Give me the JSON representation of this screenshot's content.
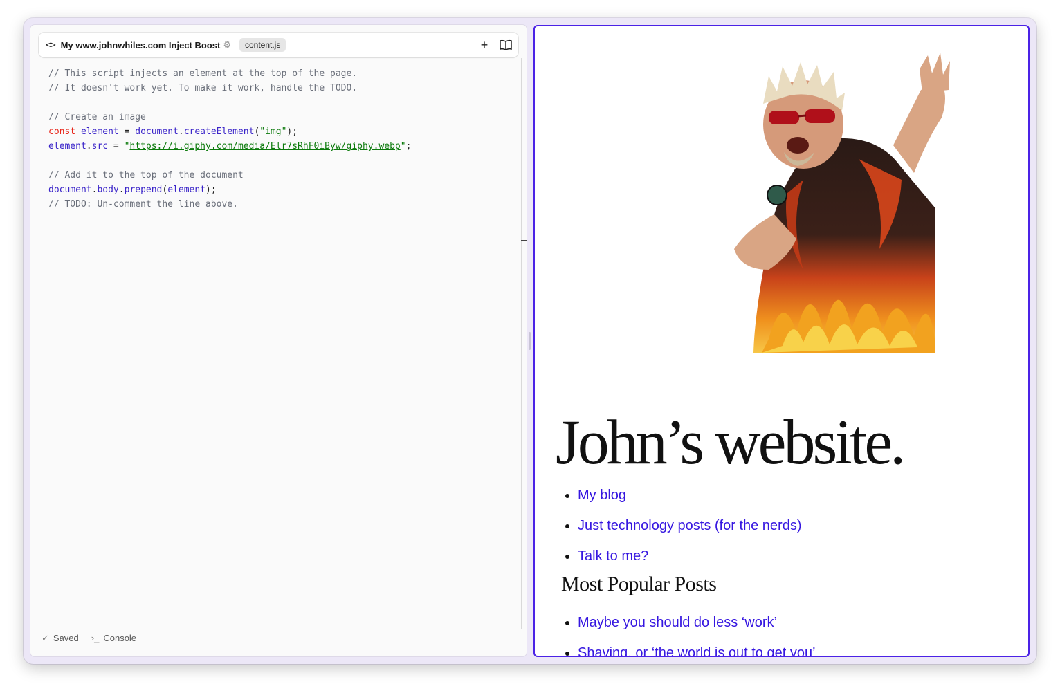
{
  "editor": {
    "project_title": "My www.johnwhiles.com Inject Boost",
    "file_tab": "content.js",
    "code_lines": [
      [
        {
          "t": "// This script injects an element at the top of the page.",
          "c": "c"
        }
      ],
      [
        {
          "t": "// It doesn't work yet. To make it work, handle the TODO.",
          "c": "c"
        }
      ],
      [],
      [
        {
          "t": "// Create an image",
          "c": "c"
        }
      ],
      [
        {
          "t": "const",
          "c": "kw"
        },
        {
          "t": " ",
          "c": "p"
        },
        {
          "t": "element",
          "c": "id"
        },
        {
          "t": " = ",
          "c": "p"
        },
        {
          "t": "document",
          "c": "id"
        },
        {
          "t": ".",
          "c": "p"
        },
        {
          "t": "createElement",
          "c": "id"
        },
        {
          "t": "(",
          "c": "p"
        },
        {
          "t": "\"img\"",
          "c": "str"
        },
        {
          "t": ");",
          "c": "p"
        }
      ],
      [
        {
          "t": "element",
          "c": "id"
        },
        {
          "t": ".",
          "c": "p"
        },
        {
          "t": "src",
          "c": "id"
        },
        {
          "t": " = ",
          "c": "p"
        },
        {
          "t": "\"",
          "c": "str"
        },
        {
          "t": "https://i.giphy.com/media/Elr7sRhF0iByw/giphy.webp",
          "c": "url"
        },
        {
          "t": "\"",
          "c": "str"
        },
        {
          "t": ";",
          "c": "p"
        }
      ],
      [],
      [
        {
          "t": "// Add it to the top of the document",
          "c": "c"
        }
      ],
      [
        {
          "t": "document",
          "c": "id"
        },
        {
          "t": ".",
          "c": "p"
        },
        {
          "t": "body",
          "c": "id"
        },
        {
          "t": ".",
          "c": "p"
        },
        {
          "t": "prepend",
          "c": "id"
        },
        {
          "t": "(",
          "c": "p"
        },
        {
          "t": "element",
          "c": "id"
        },
        {
          "t": ");",
          "c": "p"
        }
      ],
      [
        {
          "t": "// TODO: Un-comment the line above.",
          "c": "c"
        }
      ]
    ],
    "footer": {
      "saved_label": "Saved",
      "console_label": "Console"
    },
    "icons": {
      "code": "code-brackets-icon",
      "gear": "gear-icon",
      "add": "plus-icon",
      "docs": "open-book-icon"
    }
  },
  "preview": {
    "site_title": "John’s website.",
    "nav_links": [
      "My blog",
      "Just technology posts (for the nerds)",
      "Talk to me?"
    ],
    "popular_heading": "Most Popular Posts",
    "popular_links": [
      "Maybe you should do less ‘work’",
      "Shaving, or ‘the world is out to get you’"
    ]
  },
  "colors": {
    "accent": "#4b22e6",
    "link": "#3617e0",
    "keyword": "#e8261a",
    "identifier": "#3b25c9",
    "string": "#0b7a0b",
    "comment": "#6a6f7a"
  }
}
